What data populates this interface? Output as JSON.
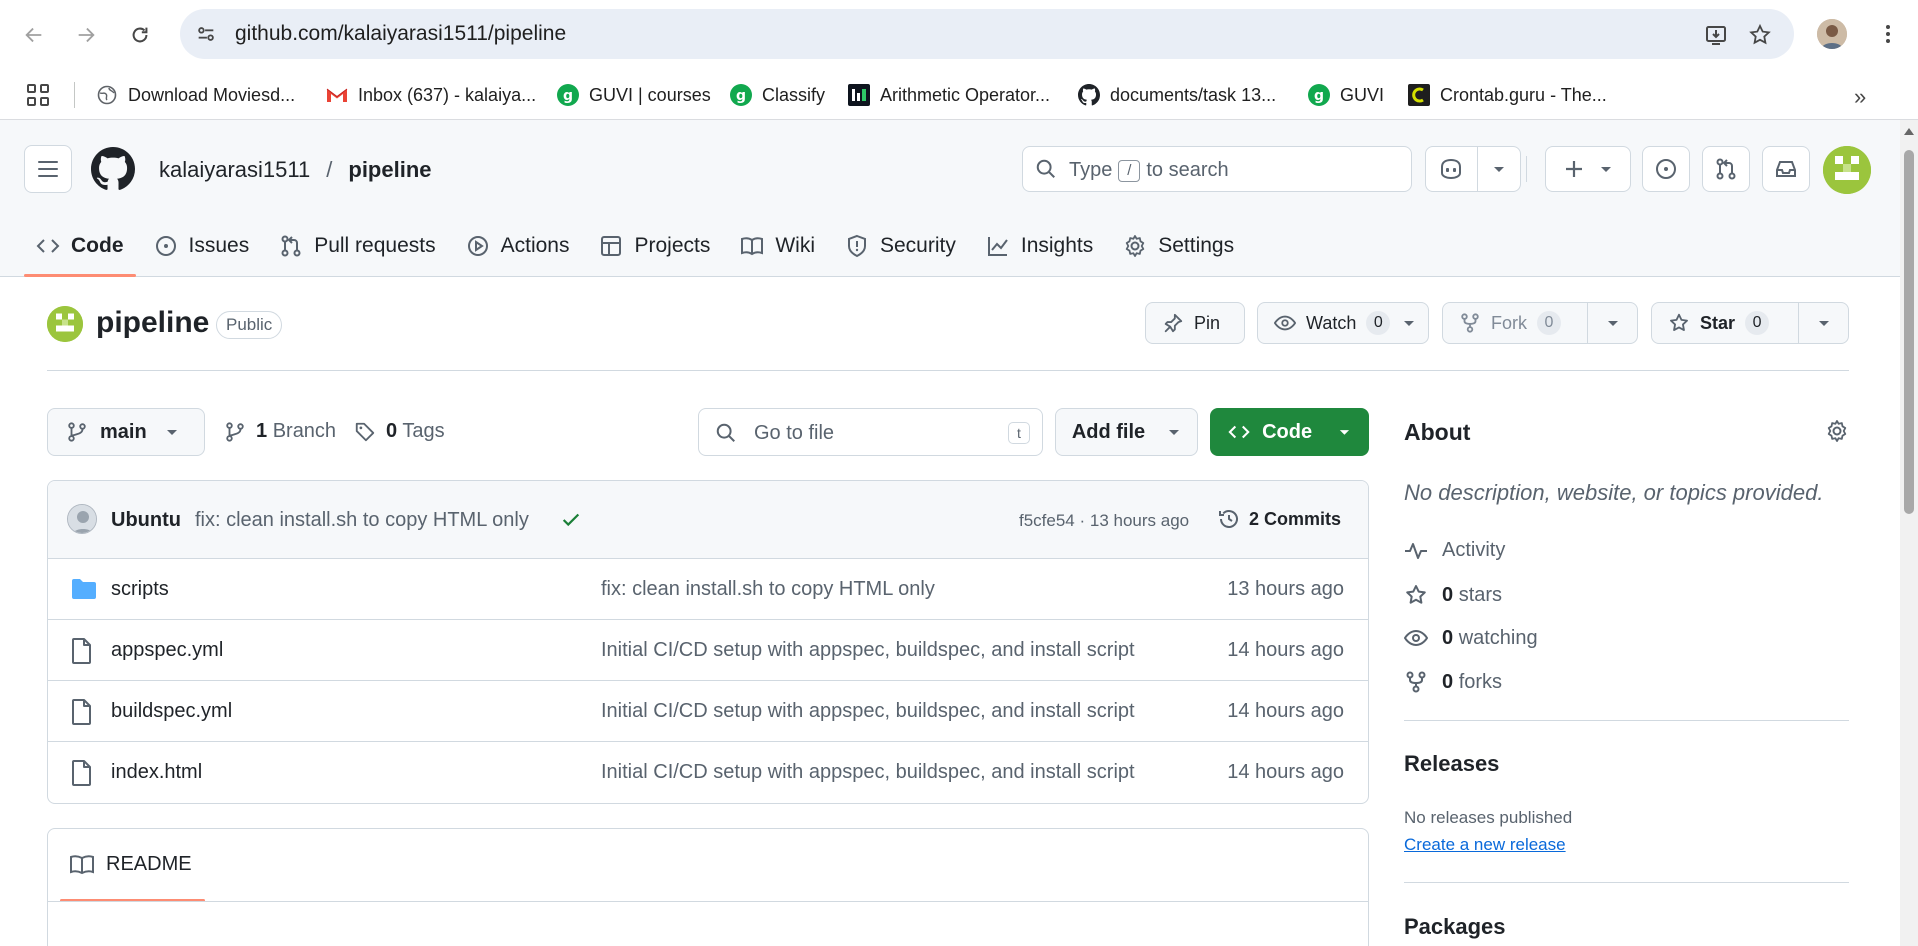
{
  "browser": {
    "url": "github.com/kalaiyarasi1511/pipeline",
    "bookmarks": [
      {
        "label": "Download Moviesd...",
        "icon": "globe-icon"
      },
      {
        "label": "Inbox (637) - kalaiya...",
        "icon": "gmail-icon"
      },
      {
        "label": "GUVI | courses",
        "icon": "guvi-icon"
      },
      {
        "label": "Classify",
        "icon": "guvi-icon"
      },
      {
        "label": "Arithmetic Operator...",
        "icon": "hackerrank-icon"
      },
      {
        "label": "documents/task 13...",
        "icon": "github-icon"
      },
      {
        "label": "GUVI",
        "icon": "guvi-icon"
      },
      {
        "label": "Crontab.guru - The...",
        "icon": "crontab-icon"
      }
    ]
  },
  "header": {
    "owner": "kalaiyarasi1511",
    "separator": "/",
    "repo": "pipeline",
    "search_type": "Type",
    "search_key": "/",
    "search_rest": "to search"
  },
  "tabs": [
    {
      "label": "Code",
      "icon": "code-icon"
    },
    {
      "label": "Issues",
      "icon": "issue-icon"
    },
    {
      "label": "Pull requests",
      "icon": "pull-request-icon"
    },
    {
      "label": "Actions",
      "icon": "play-icon"
    },
    {
      "label": "Projects",
      "icon": "table-icon"
    },
    {
      "label": "Wiki",
      "icon": "book-icon"
    },
    {
      "label": "Security",
      "icon": "shield-icon"
    },
    {
      "label": "Insights",
      "icon": "graph-icon"
    },
    {
      "label": "Settings",
      "icon": "gear-icon"
    }
  ],
  "repo": {
    "name": "pipeline",
    "visibility": "Public",
    "pin_label": "Pin",
    "watch_label": "Watch",
    "watch_count": "0",
    "fork_label": "Fork",
    "fork_count": "0",
    "star_label": "Star",
    "star_count": "0"
  },
  "controls": {
    "branch": "main",
    "branch_count": "1",
    "branch_label": "Branch",
    "tag_count": "0",
    "tag_label": "Tags",
    "goto_placeholder": "Go to file",
    "goto_key": "t",
    "add_file": "Add file",
    "code_button": "Code"
  },
  "commit": {
    "author": "Ubuntu",
    "message": "fix: clean install.sh to copy HTML only",
    "meta": "f5cfe54 · 13 hours ago",
    "commits_label": "2 Commits"
  },
  "files": [
    {
      "name": "scripts",
      "type": "folder",
      "message": "fix: clean install.sh to copy HTML only",
      "age": "13 hours ago"
    },
    {
      "name": "appspec.yml",
      "type": "file",
      "message": "Initial CI/CD setup with appspec, buildspec, and install script",
      "age": "14 hours ago"
    },
    {
      "name": "buildspec.yml",
      "type": "file",
      "message": "Initial CI/CD setup with appspec, buildspec, and install script",
      "age": "14 hours ago"
    },
    {
      "name": "index.html",
      "type": "file",
      "message": "Initial CI/CD setup with appspec, buildspec, and install script",
      "age": "14 hours ago"
    }
  ],
  "readme": {
    "label": "README"
  },
  "about": {
    "title": "About",
    "description": "No description, website, or topics provided.",
    "activity": "Activity",
    "stars_count": "0",
    "stars_label": "stars",
    "watching_count": "0",
    "watching_label": "watching",
    "forks_count": "0",
    "forks_label": "forks"
  },
  "releases": {
    "title": "Releases",
    "empty": "No releases published",
    "create_link": "Create a new release"
  },
  "packages": {
    "title": "Packages"
  },
  "colors": {
    "accent_green": "#1f883d",
    "tab_underline": "#fd8c73",
    "link_blue": "#0969da",
    "avatar_green": "#9bc53d"
  }
}
